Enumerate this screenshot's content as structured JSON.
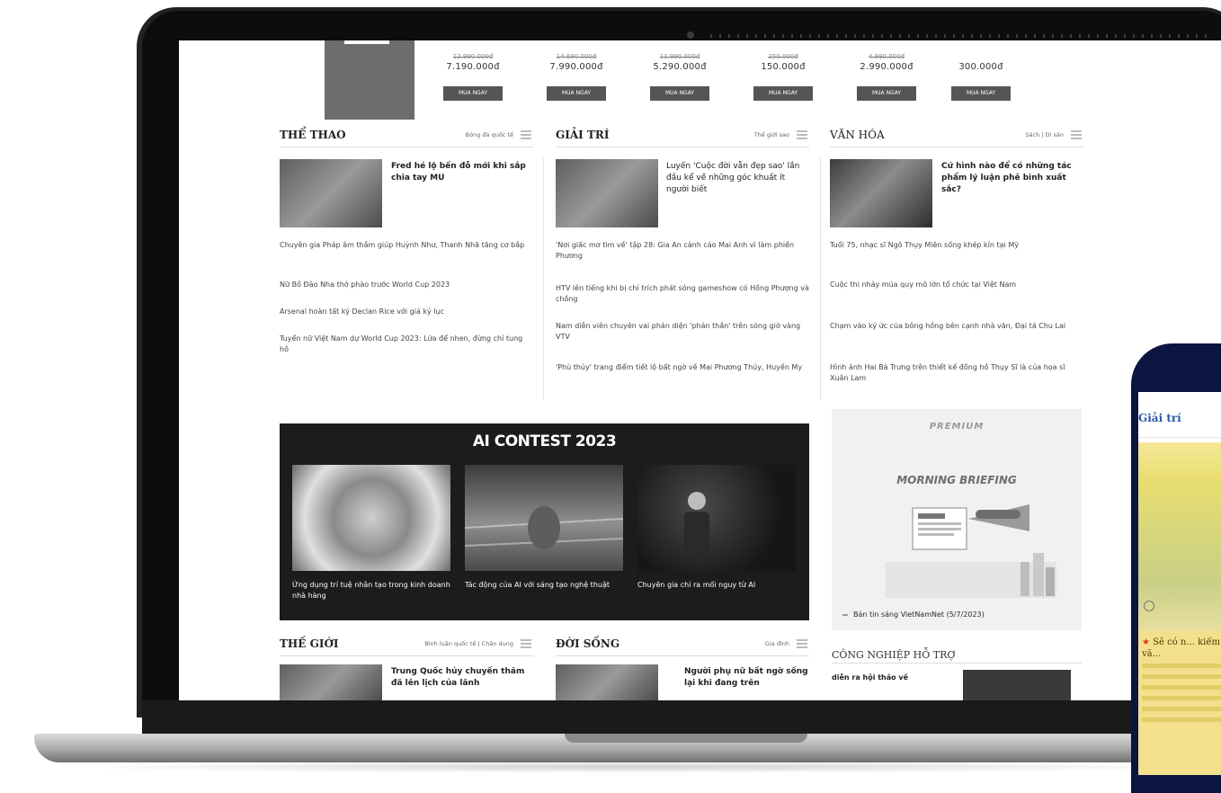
{
  "promo": {
    "items": [
      {
        "old": "12.990.000đ",
        "price": "7.190.000đ",
        "button": "MUA NGAY"
      },
      {
        "old": "14.690.000đ",
        "price": "7.990.000đ",
        "button": "MUA NGAY"
      },
      {
        "old": "11.990.000đ",
        "price": "5.290.000đ",
        "button": "MUA NGAY"
      },
      {
        "old": "250.000đ",
        "price": "150.000đ",
        "button": "MUA NGAY"
      },
      {
        "old": "4.990.000đ",
        "price": "2.990.000đ",
        "button": "MUA NGAY"
      },
      {
        "old": "",
        "price": "300.000đ",
        "button": "MUA NGAY"
      }
    ]
  },
  "sections": {
    "the_thao": {
      "title": "THỂ THAO",
      "sub": "Bóng đá quốc tế",
      "lead": "Fred hé lộ bến đỗ mới khi sắp chia tay MU",
      "articles": [
        "Chuyên gia Pháp âm thầm giúp Huỳnh Như, Thanh Nhã tăng cơ bắp",
        "Nữ Bồ Đào Nha thở phào trước World Cup 2023",
        "Arsenal hoàn tất ký Declan Rice với giá kỷ lục",
        "Tuyển nữ Việt Nam dự World Cup 2023: Lửa để nhen, đừng chỉ tung hô"
      ]
    },
    "giai_tri": {
      "title": "GIẢI TRÍ",
      "sub": "Thế giới sao",
      "lead": "Luyến 'Cuộc đời vẫn đẹp sao' lần đầu kể về những góc khuất ít người biết",
      "articles": [
        "'Nơi giấc mơ tìm về' tập 28: Gia An cảnh cáo Mai Anh vì làm phiền Phương",
        "HTV lên tiếng khi bị chỉ trích phát sóng gameshow có Hồng Phượng và chồng",
        "Nam diễn viên chuyên vai phản diện 'phản thần' trên sóng giờ vàng VTV",
        "'Phù thủy' trang điểm tiết lộ bất ngờ về Mai Phương Thúy, Huyền My"
      ]
    },
    "van_hoa": {
      "title": "VĂN HÓA",
      "sub": "Sách | Di sản",
      "lead": "Cứ hình nào để có những tác phẩm lý luận phê bình xuất sắc?",
      "articles": [
        "Tuổi 75, nhạc sĩ Ngô Thụy Miên sống khép kín tại Mỹ",
        "Cuộc thi nhảy múa quy mô lớn tổ chức tại Việt Nam",
        "Chạm vào ký ức của bông hồng bên cạnh nhà văn, Đại tá Chu Lai",
        "Hình ảnh Hai Bà Trưng trên thiết kế đồng hồ Thụy Sĩ là của họa sĩ Xuân Lam"
      ]
    }
  },
  "contest": {
    "title": "AI CONTEST 2023",
    "items": [
      {
        "caption": "Ứng dụng trí tuệ nhân tạo trong kinh doanh nhà hàng"
      },
      {
        "caption": "Tác động của AI với sáng tạo nghệ thuật"
      },
      {
        "caption": "Chuyên gia chỉ ra mối nguy từ AI"
      }
    ]
  },
  "premium": {
    "logo": "PREMIUM",
    "subtitle": "MORNING BRIEFING",
    "caption": "Bản tin sáng VietNamNet (5/7/2023)"
  },
  "bottom": {
    "the_gioi": {
      "title": "THẾ GIỚI",
      "sub": "Bình luận quốc tế | Chân dung",
      "lead": "Trung Quốc hủy chuyến thăm đã lên lịch của lãnh"
    },
    "doi_song": {
      "title": "ĐỜI SỐNG",
      "sub": "Gia đình",
      "lead": "Người phụ nữ bất ngờ sống lại khi đang trên"
    },
    "cong_nghiep": {
      "title": "CÔNG NGHIỆP HỖ TRỢ",
      "lead": "diễn ra hội thảo về"
    }
  },
  "phone": {
    "section_title": "Giải trí",
    "headline": "Sẽ có n... kiếm vă..."
  },
  "colors": {
    "phone_frame": "#0c1440",
    "phone_accent": "#2a5aa6",
    "phone_yellow": "#f4e08c"
  }
}
